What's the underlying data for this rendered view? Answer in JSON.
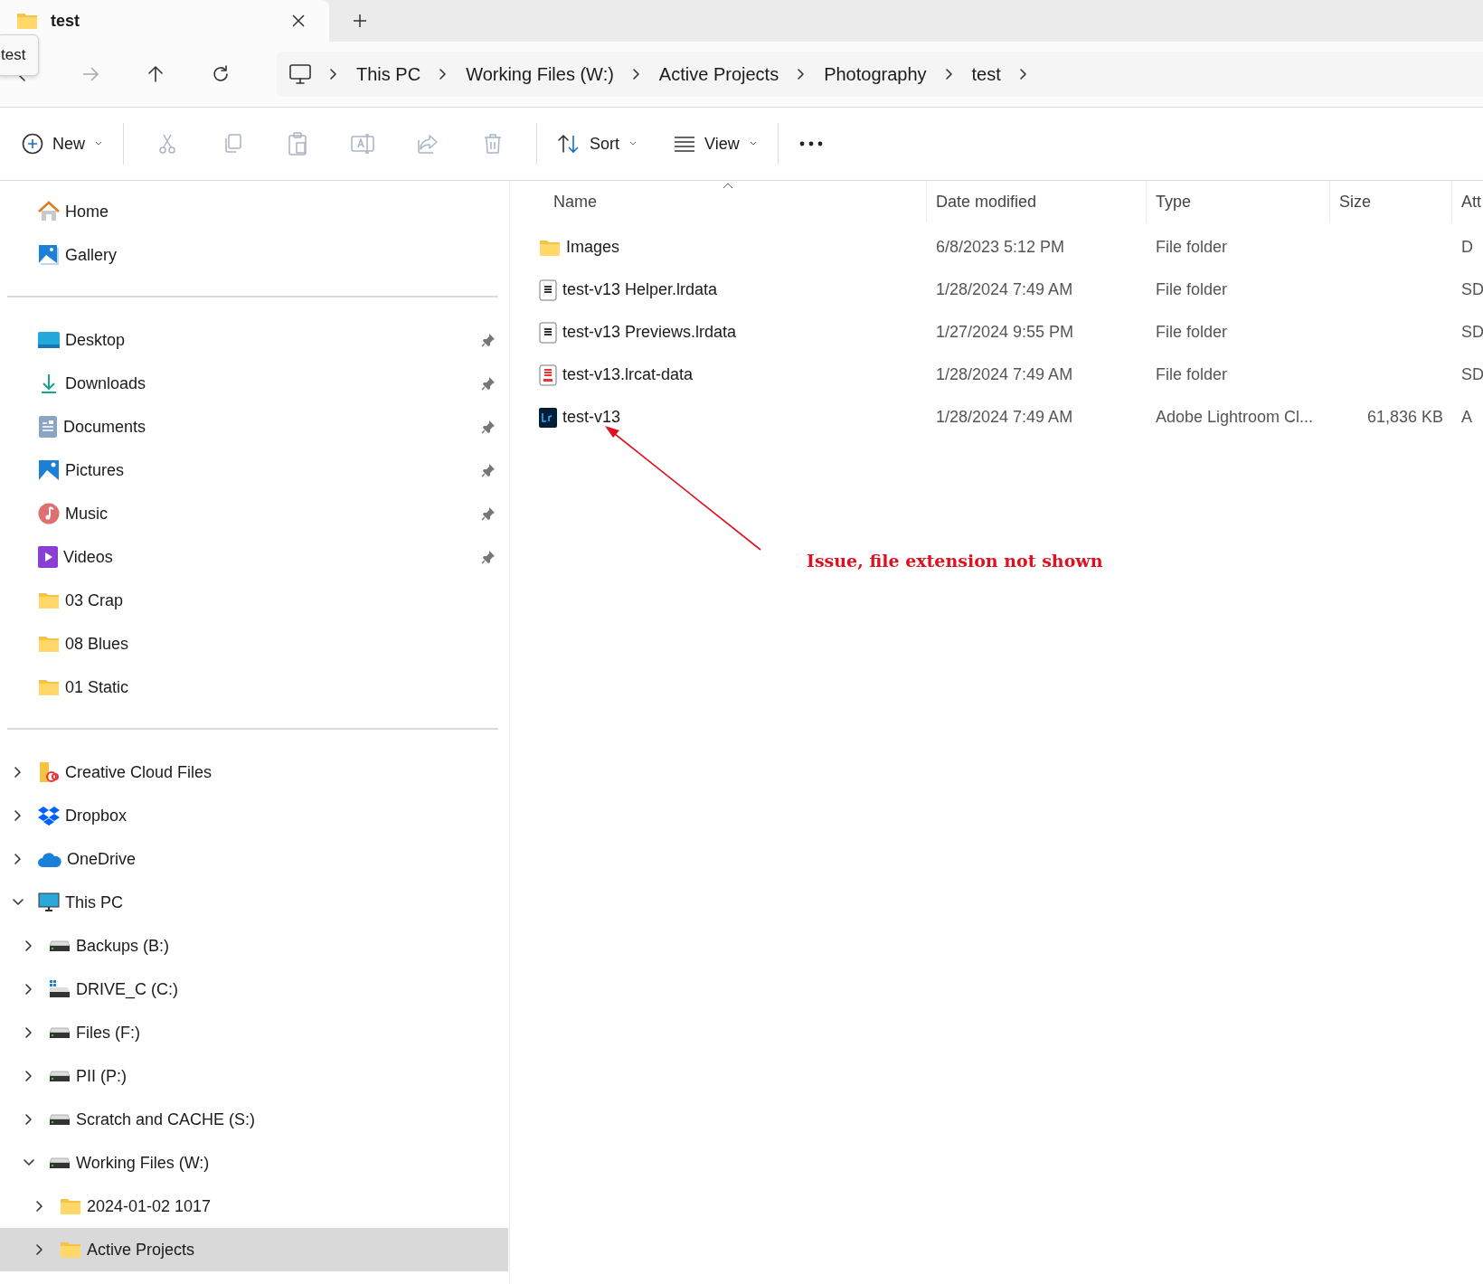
{
  "tab": {
    "title": "test",
    "tooltip": "test"
  },
  "breadcrumb": [
    "This PC",
    "Working Files (W:)",
    "Active Projects",
    "Photography",
    "test"
  ],
  "toolbar": {
    "new_label": "New",
    "tools": [
      {
        "kind": "cut",
        "disabled": true
      },
      {
        "kind": "copy",
        "disabled": true
      },
      {
        "kind": "paste",
        "disabled": true
      },
      {
        "kind": "rename",
        "disabled": true
      },
      {
        "kind": "share",
        "disabled": true
      },
      {
        "kind": "delete",
        "disabled": true
      }
    ],
    "sort_label": "Sort",
    "view_label": "View"
  },
  "sidebar": {
    "quick": [
      {
        "label": "Home",
        "kind": "home"
      },
      {
        "label": "Gallery",
        "kind": "gallery"
      }
    ],
    "pinned": [
      {
        "label": "Desktop",
        "kind": "desktop",
        "pinned": true
      },
      {
        "label": "Downloads",
        "kind": "downloads",
        "pinned": true
      },
      {
        "label": "Documents",
        "kind": "documents",
        "pinned": true
      },
      {
        "label": "Pictures",
        "kind": "pictures",
        "pinned": true
      },
      {
        "label": "Music",
        "kind": "music",
        "pinned": true
      },
      {
        "label": "Videos",
        "kind": "videos",
        "pinned": true
      },
      {
        "label": "03 Crap",
        "kind": "folder",
        "pinned": false
      },
      {
        "label": "08 Blues",
        "kind": "folder",
        "pinned": false
      },
      {
        "label": "01 Static",
        "kind": "folder",
        "pinned": false
      }
    ],
    "tree": [
      {
        "label": "Creative Cloud Files",
        "kind": "cc",
        "expanded": false,
        "selected": false
      },
      {
        "label": "Dropbox",
        "kind": "dropbox",
        "expanded": false,
        "selected": false
      },
      {
        "label": "OneDrive",
        "kind": "cloud",
        "expanded": false,
        "selected": false
      },
      {
        "label": "This PC",
        "kind": "pc",
        "expanded": true,
        "selected": false,
        "children": [
          {
            "label": "Backups (B:)",
            "kind": "drive",
            "expanded": false,
            "selected": false
          },
          {
            "label": "DRIVE_C (C:)",
            "kind": "windrive",
            "expanded": false,
            "selected": false
          },
          {
            "label": "Files (F:)",
            "kind": "drive",
            "expanded": false,
            "selected": false
          },
          {
            "label": "PII (P:)",
            "kind": "drive",
            "expanded": false,
            "selected": false
          },
          {
            "label": "Scratch and CACHE (S:)",
            "kind": "drive",
            "expanded": false,
            "selected": false
          },
          {
            "label": "Working Files (W:)",
            "kind": "drive",
            "expanded": true,
            "selected": false,
            "children": [
              {
                "label": "2024-01-02 1017",
                "kind": "folder",
                "expanded": false,
                "selected": false
              },
              {
                "label": "Active Projects",
                "kind": "folder",
                "expanded": false,
                "selected": true
              }
            ]
          }
        ]
      }
    ]
  },
  "table": {
    "columns": [
      {
        "label": "Name",
        "sorted": true
      },
      {
        "label": "Date modified",
        "sorted": false
      },
      {
        "label": "Type",
        "sorted": false
      },
      {
        "label": "Size",
        "sorted": false
      },
      {
        "label": "Att",
        "sorted": false
      }
    ],
    "rows": [
      {
        "kind": "folder",
        "name": "Images",
        "date": "6/8/2023 5:12 PM",
        "type": "File folder",
        "attr": "D"
      },
      {
        "kind": "data",
        "name": "test-v13 Helper.lrdata",
        "date": "1/28/2024 7:49 AM",
        "type": "File folder",
        "attr": "SD"
      },
      {
        "kind": "data",
        "name": "test-v13 Previews.lrdata",
        "date": "1/27/2024 9:55 PM",
        "type": "File folder",
        "attr": "SD"
      },
      {
        "kind": "reddata",
        "name": "test-v13.lrcat-data",
        "date": "1/28/2024 7:49 AM",
        "type": "File folder",
        "attr": "SD"
      },
      {
        "kind": "lrc",
        "name": "test-v13",
        "date": "1/28/2024 7:49 AM",
        "type": "Adobe Lightroom Cl...",
        "size": "61,836 KB",
        "attr": "A"
      }
    ]
  },
  "annotation": "Issue, file extension not shown"
}
